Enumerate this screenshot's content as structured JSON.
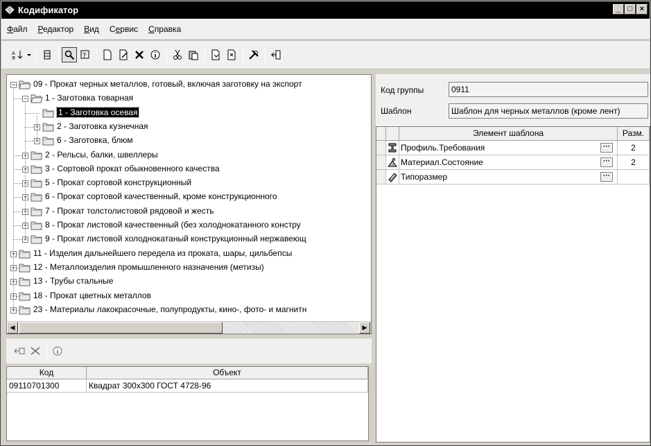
{
  "window": {
    "title": "Кодификатор"
  },
  "menu": [
    {
      "pre": "",
      "ul": "Ф",
      "post": "айл"
    },
    {
      "pre": "",
      "ul": "Р",
      "post": "едактор"
    },
    {
      "pre": "",
      "ul": "В",
      "post": "ид"
    },
    {
      "pre": "С",
      "ul": "е",
      "post": "рвис"
    },
    {
      "pre": "",
      "ul": "С",
      "post": "правка"
    }
  ],
  "toolbar_icons": [
    "sort-az-icon",
    "dropdown-arrow-icon",
    "grid-icon",
    "find-icon",
    "filter-icon",
    "new-doc-icon",
    "edit-icon",
    "delete-icon",
    "info-icon",
    "cut-icon",
    "paste-icon",
    "import-icon",
    "export-icon",
    "settings-icon",
    "exit-icon"
  ],
  "tree": [
    {
      "level": 0,
      "expanded": true,
      "open": true,
      "text": "09 - Прокат черных металлов, готовый, включая заготовку на экспорт"
    },
    {
      "level": 1,
      "expanded": true,
      "open": true,
      "text": "1 - Заготовка товарная"
    },
    {
      "level": 2,
      "leaf": true,
      "selected": true,
      "text": "1 - Заготовка осевая"
    },
    {
      "level": 2,
      "expanded": false,
      "text": "2 - Заготовка кузнечная"
    },
    {
      "level": 2,
      "expanded": false,
      "text": "6 - Заготовка, блюм"
    },
    {
      "level": 1,
      "expanded": false,
      "text": "2 - Рельсы, балки, швеллеры"
    },
    {
      "level": 1,
      "expanded": false,
      "text": "3 - Сортовой прокат обыкновенного качества"
    },
    {
      "level": 1,
      "expanded": false,
      "text": "5 - Прокат сортовой конструкционный"
    },
    {
      "level": 1,
      "expanded": false,
      "text": "6 - Прокат сортовой качественный, кроме конструкционного"
    },
    {
      "level": 1,
      "expanded": false,
      "text": "7 - Прокат толстолистовой рядовой и жесть"
    },
    {
      "level": 1,
      "expanded": false,
      "text": "8 - Прокат листовой качественный (без холоднокатанного констру"
    },
    {
      "level": 1,
      "expanded": false,
      "text": "9 - Прокат листовой холоднокатаный конструкционный нержавеющ"
    },
    {
      "level": 0,
      "expanded": false,
      "text": "11 - Изделия дальнейшего передела из проката, шары, цильбепсы"
    },
    {
      "level": 0,
      "expanded": false,
      "text": "12 - Металлоизделия промышленного назначения (метизы)"
    },
    {
      "level": 0,
      "expanded": false,
      "text": "13 - Трубы стальные"
    },
    {
      "level": 0,
      "expanded": false,
      "text": "18 - Прокат цветных металлов"
    },
    {
      "level": 0,
      "expanded": false,
      "text": "23 - Материалы лакокрасочные, полупродукты, кино-, фото- и магнитн"
    }
  ],
  "objects": {
    "headers": {
      "code": "Код",
      "object": "Объект"
    },
    "rows": [
      {
        "code": "09110701300",
        "object": "Квадрат 300x300 ГОСТ 4728-96"
      }
    ]
  },
  "group": {
    "code_label": "Код группы",
    "code_value": "0911",
    "template_label": "Шаблон",
    "template_value": "Шаблон для черных металлов (кроме лент)"
  },
  "template_table": {
    "headers": {
      "element": "Элемент шаблона",
      "size": "Разм."
    },
    "rows": [
      {
        "icon": "i-beam-icon",
        "name": "Профиль.Требования",
        "size": "2"
      },
      {
        "icon": "material-icon",
        "name": "Материал.Состояние",
        "size": "2"
      },
      {
        "icon": "size-icon",
        "name": "Типоразмер",
        "size": ""
      }
    ],
    "ellipsis": "···"
  },
  "scroll": {
    "left_arrow": "◀",
    "right_arrow": "▶"
  }
}
